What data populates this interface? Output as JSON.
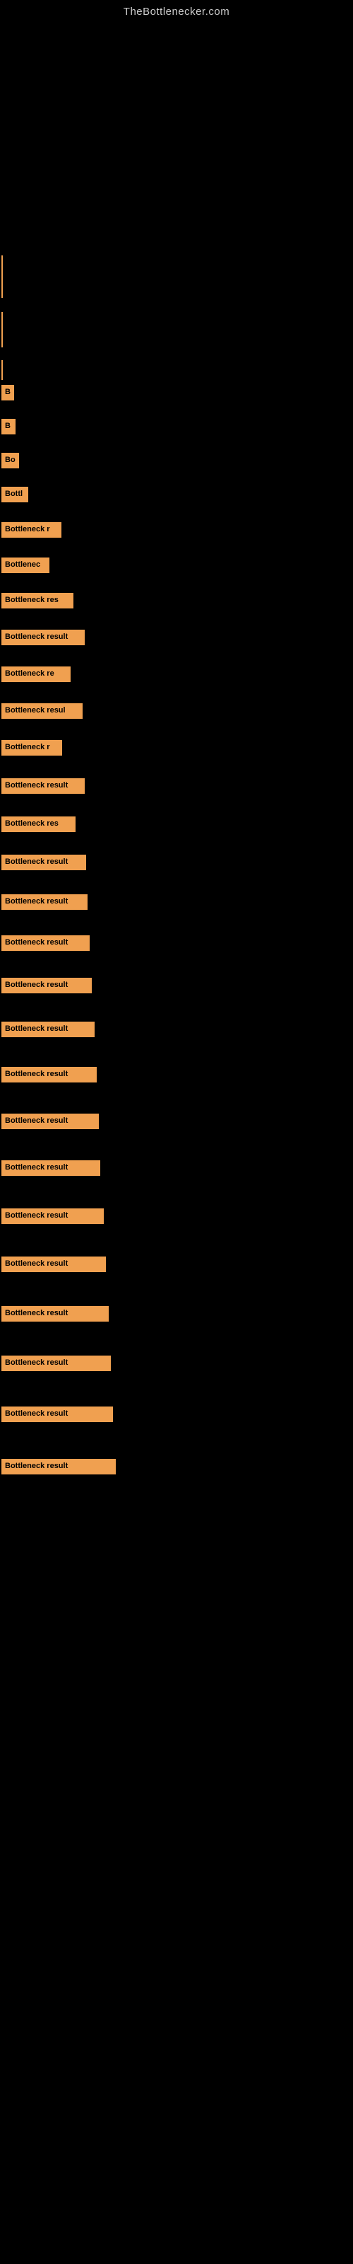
{
  "site": {
    "title": "TheBottlenecker.com"
  },
  "bars": [
    {
      "id": 1,
      "label": "B",
      "width": 18,
      "top_gap": 0
    },
    {
      "id": 2,
      "label": "B",
      "width": 20,
      "top_gap": 18
    },
    {
      "id": 3,
      "label": "Bo",
      "width": 25,
      "top_gap": 18
    },
    {
      "id": 4,
      "label": "Bottl",
      "width": 38,
      "top_gap": 18
    },
    {
      "id": 5,
      "label": "Bottleneck r",
      "width": 85,
      "top_gap": 20
    },
    {
      "id": 6,
      "label": "Bottlenec",
      "width": 68,
      "top_gap": 20
    },
    {
      "id": 7,
      "label": "Bottleneck res",
      "width": 102,
      "top_gap": 20
    },
    {
      "id": 8,
      "label": "Bottleneck result",
      "width": 118,
      "top_gap": 22
    },
    {
      "id": 9,
      "label": "Bottleneck re",
      "width": 98,
      "top_gap": 22
    },
    {
      "id": 10,
      "label": "Bottleneck resul",
      "width": 115,
      "top_gap": 22
    },
    {
      "id": 11,
      "label": "Bottleneck r",
      "width": 86,
      "top_gap": 22
    },
    {
      "id": 12,
      "label": "Bottleneck result",
      "width": 118,
      "top_gap": 24
    },
    {
      "id": 13,
      "label": "Bottleneck res",
      "width": 105,
      "top_gap": 24
    },
    {
      "id": 14,
      "label": "Bottleneck result",
      "width": 120,
      "top_gap": 24
    },
    {
      "id": 15,
      "label": "Bottleneck result",
      "width": 122,
      "top_gap": 26
    },
    {
      "id": 16,
      "label": "Bottleneck result",
      "width": 125,
      "top_gap": 28
    },
    {
      "id": 17,
      "label": "Bottleneck result",
      "width": 128,
      "top_gap": 30
    },
    {
      "id": 18,
      "label": "Bottleneck result",
      "width": 132,
      "top_gap": 32
    },
    {
      "id": 19,
      "label": "Bottleneck result",
      "width": 135,
      "top_gap": 34
    },
    {
      "id": 20,
      "label": "Bottleneck result",
      "width": 138,
      "top_gap": 36
    },
    {
      "id": 21,
      "label": "Bottleneck result",
      "width": 140,
      "top_gap": 36
    },
    {
      "id": 22,
      "label": "Bottleneck result",
      "width": 145,
      "top_gap": 38
    },
    {
      "id": 23,
      "label": "Bottleneck result",
      "width": 148,
      "top_gap": 38
    },
    {
      "id": 24,
      "label": "Bottleneck result",
      "width": 152,
      "top_gap": 40
    },
    {
      "id": 25,
      "label": "Bottleneck result",
      "width": 155,
      "top_gap": 40
    },
    {
      "id": 26,
      "label": "Bottleneck result",
      "width": 158,
      "top_gap": 42
    },
    {
      "id": 27,
      "label": "Bottleneck result",
      "width": 162,
      "top_gap": 44
    }
  ]
}
